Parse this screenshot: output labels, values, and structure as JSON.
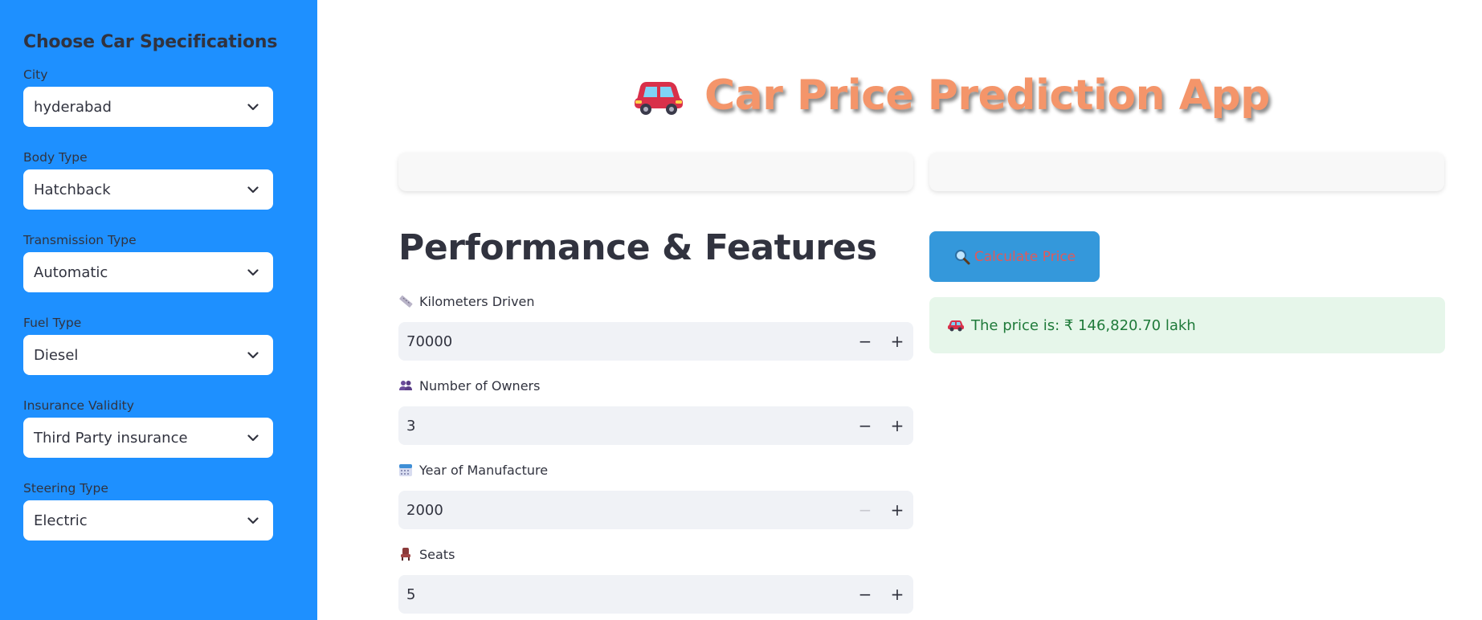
{
  "sidebar": {
    "title": "Choose Car Specifications",
    "fields": [
      {
        "label": "City",
        "value": "hyderabad"
      },
      {
        "label": "Body Type",
        "value": "Hatchback"
      },
      {
        "label": "Transmission Type",
        "value": "Automatic"
      },
      {
        "label": "Fuel Type",
        "value": "Diesel"
      },
      {
        "label": "Insurance Validity",
        "value": "Third Party insurance"
      },
      {
        "label": "Steering Type",
        "value": "Electric"
      }
    ]
  },
  "main": {
    "title": "Car Price Prediction App",
    "title_icon": "car-emoji-icon",
    "section_heading": "Performance & Features",
    "inputs": [
      {
        "label": "Kilometers Driven",
        "value": "70000",
        "icon": "ruler-icon",
        "minus_enabled": true
      },
      {
        "label": "Number of Owners",
        "value": "3",
        "icon": "people-icon",
        "minus_enabled": true
      },
      {
        "label": "Year of Manufacture",
        "value": "2000",
        "icon": "calendar-icon",
        "minus_enabled": false
      },
      {
        "label": "Seats",
        "value": "5",
        "icon": "seat-icon",
        "minus_enabled": true
      }
    ],
    "stepper": {
      "minus": "−",
      "plus": "+"
    },
    "calculate_button": "Calculate Price",
    "result_text": "The price is: ₹ 146,820.70 lakh"
  },
  "colors": {
    "sidebar_bg": "#1e90ff",
    "title": "#f4956a",
    "button_bg": "#3498db",
    "button_text": "#e05a5a",
    "result_bg": "#e6f6ea",
    "result_text": "#1f7a3a"
  }
}
